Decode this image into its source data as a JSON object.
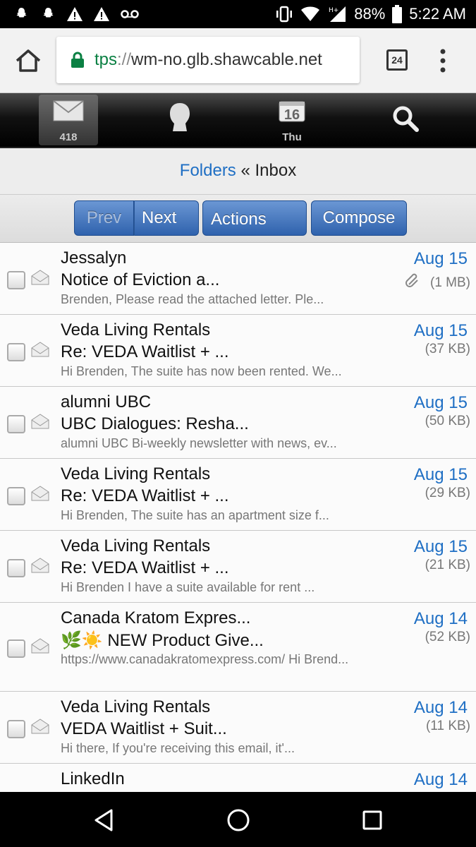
{
  "status_bar": {
    "battery": "88%",
    "time": "5:22 AM",
    "icons": [
      "snapchat-icon",
      "snapchat-icon",
      "warning-icon",
      "warning-icon",
      "voicemail-icon",
      "vibrate-icon",
      "wifi-icon",
      "signal-icon",
      "battery-icon"
    ]
  },
  "browser": {
    "url_scheme": "tps",
    "url_sep": "://",
    "url_host": "wm-no.glb.shawcable.net",
    "tab_count": "24"
  },
  "toolbar": {
    "mail_count": "418",
    "calendar_day": "16",
    "calendar_weekday": "Thu"
  },
  "breadcrumb": {
    "folders": "Folders",
    "separator": " « ",
    "current": "Inbox"
  },
  "actions": {
    "prev": "Prev",
    "next": "Next",
    "actions": "Actions",
    "compose": "Compose"
  },
  "messages": [
    {
      "from": "Jessalyn",
      "subject": "Notice of Eviction a...",
      "preview": "Brenden, Please read the attached letter. Ple...",
      "date": "Aug 15",
      "size": "(1 MB)",
      "attachment": true
    },
    {
      "from": "Veda Living Rentals",
      "subject": "Re: VEDA Waitlist + ...",
      "preview": "Hi Brenden, The suite has now been rented. We...",
      "date": "Aug 15",
      "size": "(37 KB)",
      "attachment": false
    },
    {
      "from": "alumni UBC",
      "subject": "UBC Dialogues: Resha...",
      "preview": "alumni UBC Bi-weekly newsletter with news, ev...",
      "date": "Aug 15",
      "size": "(50 KB)",
      "attachment": false
    },
    {
      "from": "Veda Living Rentals",
      "subject": "Re: VEDA Waitlist + ...",
      "preview": "Hi Brenden, The suite has an apartment size f...",
      "date": "Aug 15",
      "size": "(29 KB)",
      "attachment": false
    },
    {
      "from": "Veda Living Rentals",
      "subject": "Re: VEDA Waitlist + ...",
      "preview": "Hi Brenden I have a suite available for rent ...",
      "date": "Aug 15",
      "size": "(21 KB)",
      "attachment": false
    },
    {
      "from": "Canada Kratom Expres...",
      "subject": "🌿☀️ NEW Product Give...",
      "preview": "https://www.canadakratomexpress.com/ Hi Brend...",
      "date": "Aug 14",
      "size": "(52 KB)",
      "attachment": false
    },
    {
      "from": "Veda Living Rentals",
      "subject": "VEDA Waitlist + Suit...",
      "preview": "Hi there, If you're receiving this email, it'...",
      "date": "Aug 14",
      "size": "(11 KB)",
      "attachment": false
    },
    {
      "from": "LinkedIn",
      "subject": "",
      "preview": "",
      "date": "Aug 14",
      "size": "",
      "attachment": false
    }
  ]
}
